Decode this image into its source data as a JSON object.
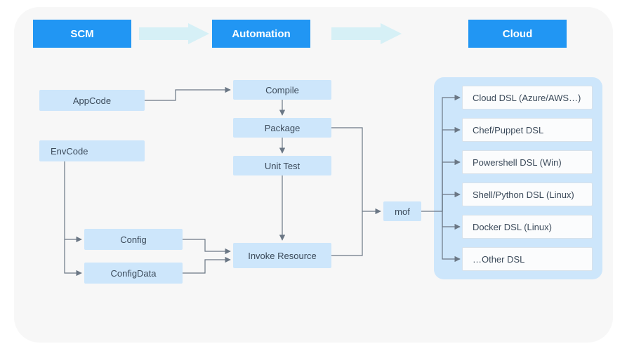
{
  "headers": {
    "scm": "SCM",
    "automation": "Automation",
    "cloud": "Cloud"
  },
  "scm": {
    "appcode": "AppCode",
    "envcode": "EnvCode",
    "config": "Config",
    "configdata": "ConfigData"
  },
  "automation": {
    "compile": "Compile",
    "package": "Package",
    "unittest": "Unit Test",
    "invoke": "Invoke Resource",
    "mof": "mof"
  },
  "cloud": {
    "items": [
      "Cloud DSL (Azure/AWS…)",
      "Chef/Puppet DSL",
      "Powershell DSL (Win)",
      "Shell/Python DSL (Linux)",
      "Docker DSL (Linux)",
      "…Other DSL"
    ]
  },
  "chart_data": {
    "type": "flow-diagram",
    "columns": [
      "SCM",
      "Automation",
      "Cloud"
    ],
    "nodes": [
      {
        "id": "appcode",
        "col": "SCM",
        "label": "AppCode"
      },
      {
        "id": "envcode",
        "col": "SCM",
        "label": "EnvCode"
      },
      {
        "id": "config",
        "col": "SCM",
        "label": "Config"
      },
      {
        "id": "configdata",
        "col": "SCM",
        "label": "ConfigData"
      },
      {
        "id": "compile",
        "col": "Automation",
        "label": "Compile"
      },
      {
        "id": "package",
        "col": "Automation",
        "label": "Package"
      },
      {
        "id": "unittest",
        "col": "Automation",
        "label": "Unit Test"
      },
      {
        "id": "invoke",
        "col": "Automation",
        "label": "Invoke Resource"
      },
      {
        "id": "mof",
        "col": "Automation",
        "label": "mof"
      },
      {
        "id": "cloud_dsl",
        "col": "Cloud",
        "label": "Cloud DSL (Azure/AWS…)"
      },
      {
        "id": "chef",
        "col": "Cloud",
        "label": "Chef/Puppet DSL"
      },
      {
        "id": "powershell",
        "col": "Cloud",
        "label": "Powershell DSL (Win)"
      },
      {
        "id": "shell",
        "col": "Cloud",
        "label": "Shell/Python DSL (Linux)"
      },
      {
        "id": "docker",
        "col": "Cloud",
        "label": "Docker DSL (Linux)"
      },
      {
        "id": "other",
        "col": "Cloud",
        "label": "…Other DSL"
      }
    ],
    "edges": [
      [
        "appcode",
        "compile"
      ],
      [
        "compile",
        "package"
      ],
      [
        "package",
        "unittest"
      ],
      [
        "unittest",
        "invoke"
      ],
      [
        "envcode",
        "config"
      ],
      [
        "envcode",
        "configdata"
      ],
      [
        "config",
        "invoke"
      ],
      [
        "configdata",
        "invoke"
      ],
      [
        "package",
        "mof"
      ],
      [
        "invoke",
        "mof"
      ],
      [
        "mof",
        "cloud_dsl"
      ],
      [
        "mof",
        "chef"
      ],
      [
        "mof",
        "powershell"
      ],
      [
        "mof",
        "shell"
      ],
      [
        "mof",
        "docker"
      ],
      [
        "mof",
        "other"
      ]
    ]
  }
}
